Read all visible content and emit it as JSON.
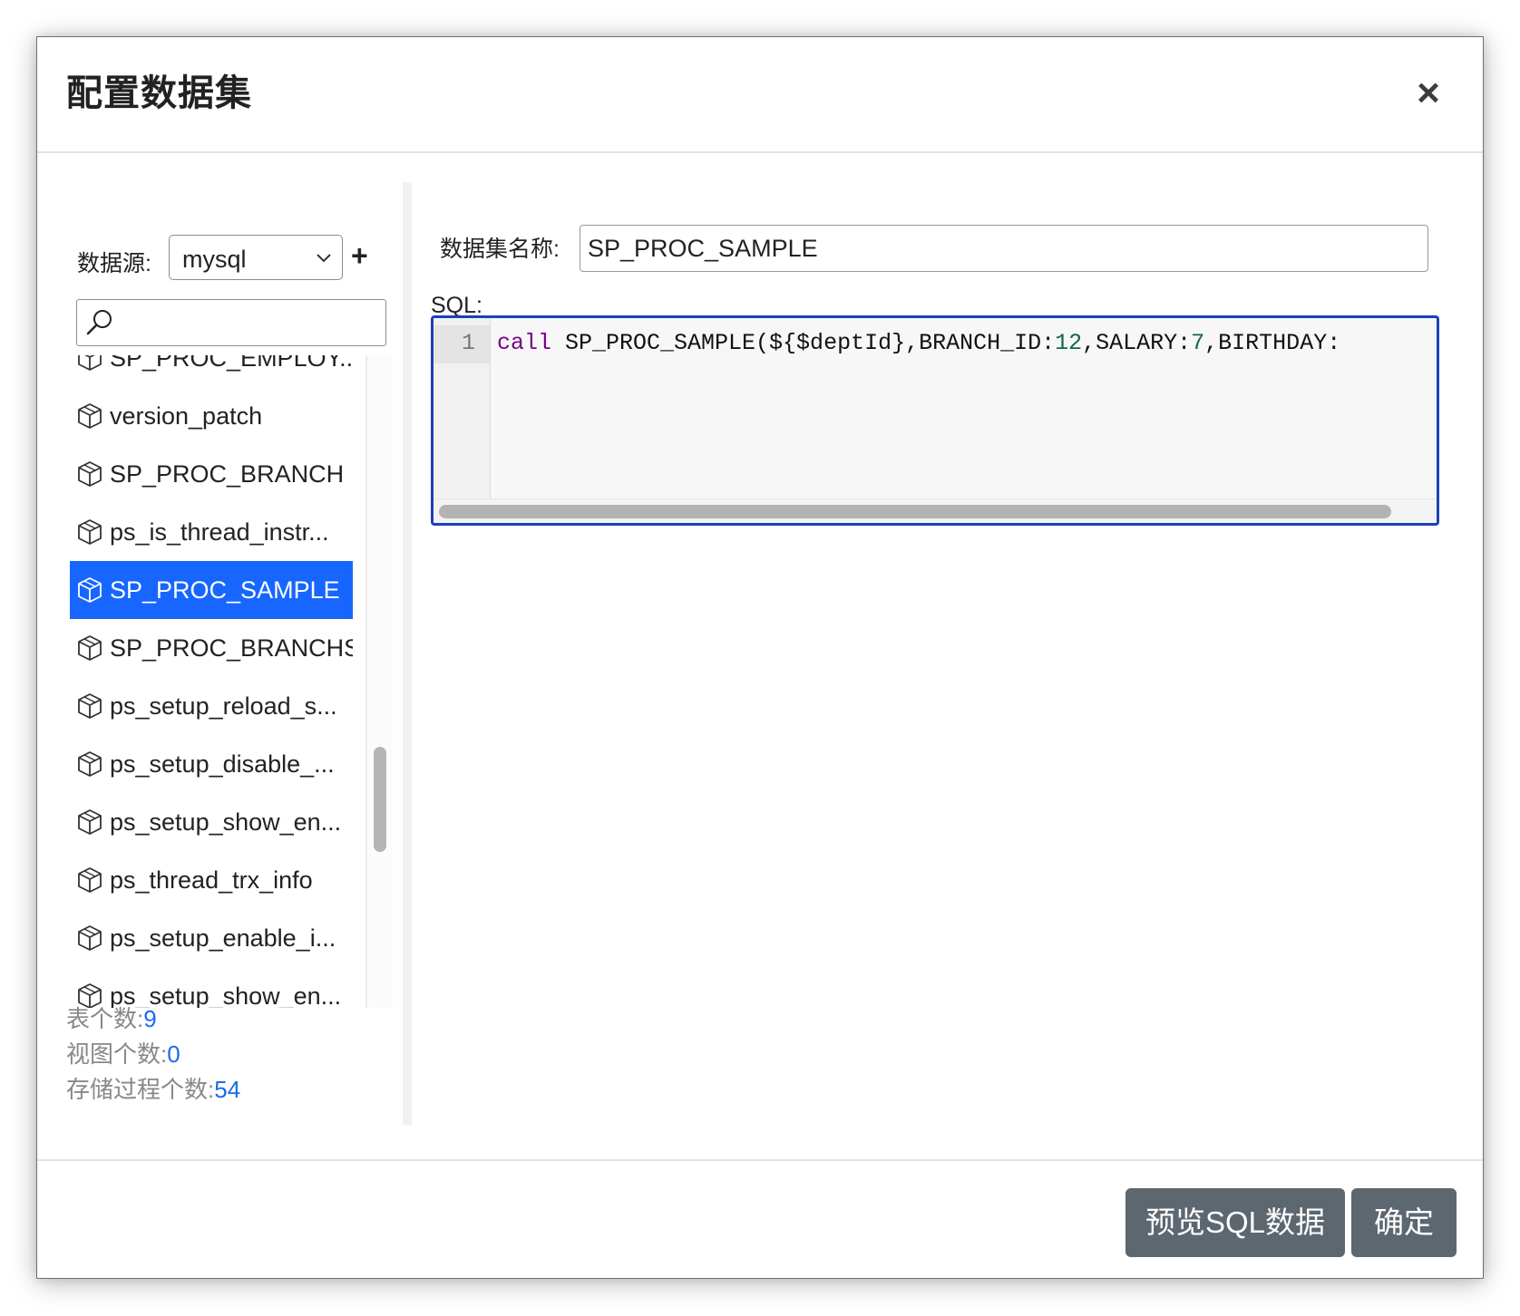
{
  "dialog": {
    "title": "配置数据集"
  },
  "datasource": {
    "label": "数据源:",
    "selected": "mysql",
    "add_label": "+"
  },
  "search": {
    "value": "",
    "placeholder": ""
  },
  "tables": {
    "items": [
      {
        "label": "SP_PROC_EMPLOY..."
      },
      {
        "label": "version_patch"
      },
      {
        "label": "SP_PROC_BRANCH"
      },
      {
        "label": "ps_is_thread_instr..."
      },
      {
        "label": "SP_PROC_SAMPLE",
        "selected": true
      },
      {
        "label": "SP_PROC_BRANCHS"
      },
      {
        "label": "ps_setup_reload_s..."
      },
      {
        "label": "ps_setup_disable_..."
      },
      {
        "label": "ps_setup_show_en..."
      },
      {
        "label": "ps_thread_trx_info"
      },
      {
        "label": "ps_setup_enable_i..."
      },
      {
        "label": "ps_setup_show_en..."
      }
    ]
  },
  "stats": {
    "tables_label": "表个数:",
    "tables_value": "9",
    "views_label": "视图个数:",
    "views_value": "0",
    "procs_label": "存储过程个数:",
    "procs_value": "54"
  },
  "dataset": {
    "name_label": "数据集名称:",
    "name_value": "SP_PROC_SAMPLE",
    "sql_label": "SQL:"
  },
  "editor": {
    "line_number": "1",
    "code": {
      "keyword": "call",
      "part1": " SP_PROC_SAMPLE(${$deptId},BRANCH_ID:",
      "num1": "12",
      "part2": ",SALARY:",
      "num2": "7",
      "part3": ",BIRTHDAY:"
    }
  },
  "footer": {
    "preview_label": "预览SQL数据",
    "ok_label": "确定"
  },
  "colors": {
    "selected_bg": "#1766ff",
    "button_bg": "#5d6770",
    "editor_border": "#1d3fbb",
    "stat_value": "#1a6ce8"
  }
}
